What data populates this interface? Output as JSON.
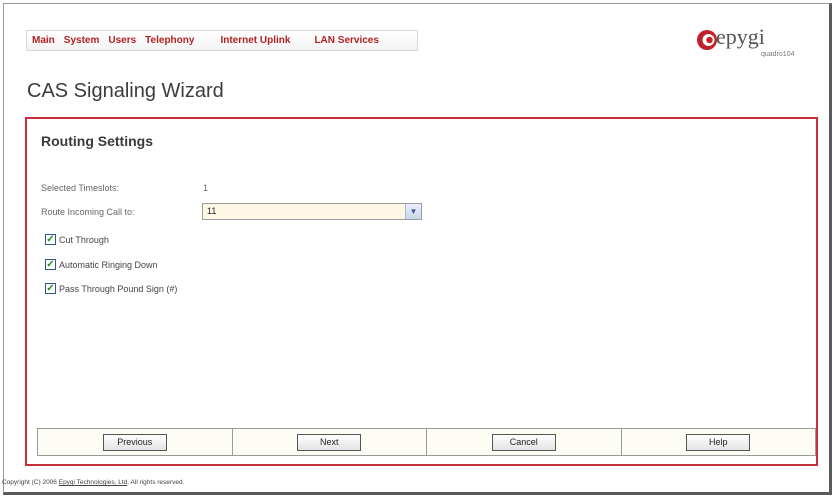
{
  "menu": {
    "items": [
      {
        "label": "Main"
      },
      {
        "label": "System"
      },
      {
        "label": "Users"
      },
      {
        "label": "Telephony"
      },
      {
        "label": "Internet Uplink"
      },
      {
        "label": "LAN Services"
      }
    ]
  },
  "logo": {
    "brand": "epygi",
    "model": "quadro104",
    "icon": "epygi-swirl-logo"
  },
  "page": {
    "title": "CAS Signaling Wizard"
  },
  "panel": {
    "section_title": "Routing Settings",
    "timeslots_label": "Selected Timeslots:",
    "timeslots_value": "1",
    "route_label": "Route Incoming Call to:",
    "route_value": "11",
    "checkboxes": [
      {
        "label": "Cut Through",
        "checked": true
      },
      {
        "label": "Automatic Ringing Down",
        "checked": true
      },
      {
        "label": "Pass Through Pound Sign (#)",
        "checked": true
      }
    ]
  },
  "buttons": {
    "previous": "Previous",
    "next": "Next",
    "cancel": "Cancel",
    "help": "Help"
  },
  "footer": {
    "prefix": "Copyright (C) 2006 ",
    "link": "Epygi Technologies, Ltd",
    "suffix": ". All rights reserved."
  },
  "colors": {
    "accent_red": "#c4303a",
    "menu_text": "#b32222",
    "dropdown_bg": "#fff7e6",
    "check_green": "#1d8f1d"
  }
}
